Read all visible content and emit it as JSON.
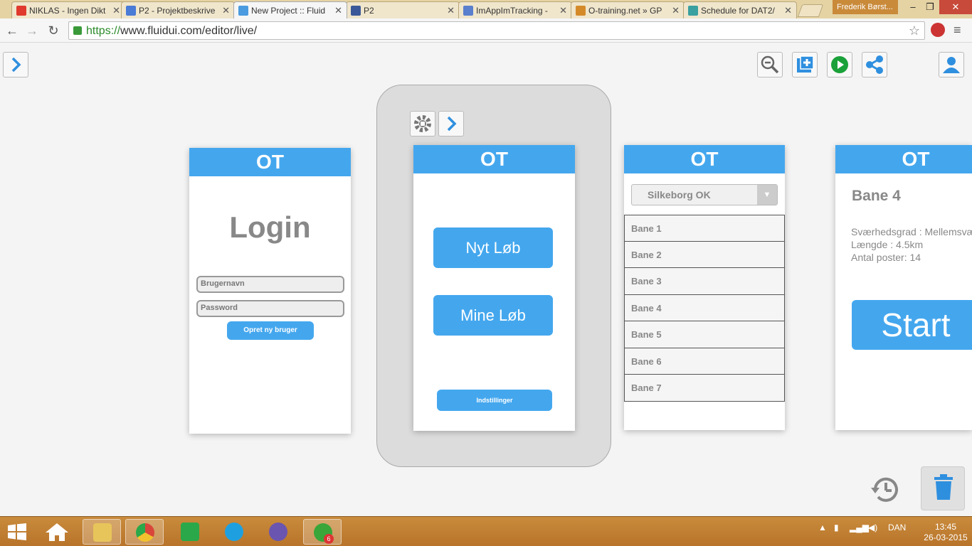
{
  "browser": {
    "tabs": [
      {
        "title": "NIKLAS - Ingen Dikt",
        "favicon_color": "#e03a2e",
        "active": false
      },
      {
        "title": "P2 - Projektbeskrive",
        "favicon_color": "#4a7bd6",
        "active": false
      },
      {
        "title": "New Project :: Fluid",
        "favicon_color": "#4a9be0",
        "active": true
      },
      {
        "title": "P2",
        "favicon_color": "#3b5998",
        "active": false
      },
      {
        "title": "ImAppImTracking -",
        "favicon_color": "#5a7fcc",
        "active": false
      },
      {
        "title": "O-training.net » GP",
        "favicon_color": "#d58a2a",
        "active": false
      },
      {
        "title": "Schedule for DAT2/",
        "favicon_color": "#3aa0a0",
        "active": false
      }
    ],
    "close_glyph": "✕",
    "profile_name": "Frederik Børst...",
    "window_controls": {
      "minimize": "–",
      "maximize": "❐",
      "close": "✕"
    },
    "url_scheme": "https://",
    "url_rest": "www.fluidui.com/editor/live/"
  },
  "editor": {
    "toolbar_icons": [
      "expand-panel-icon",
      "zoom-out-icon",
      "add-screen-icon",
      "play-icon",
      "share-icon",
      "user-icon"
    ],
    "device_icons": [
      "settings-icon",
      "next-arrow-icon"
    ],
    "bottom_icons": [
      "history-icon",
      "trash-icon"
    ],
    "accent_color": "#44a7ee"
  },
  "screens": {
    "login": {
      "header": "OT",
      "title": "Login",
      "username_placeholder": "Brugernavn",
      "password_placeholder": "Password",
      "create_user_label": "Opret ny bruger"
    },
    "menu": {
      "header": "OT",
      "new_run_label": "Nyt Løb",
      "my_runs_label": "Mine Løb",
      "settings_label": "Indstillinger"
    },
    "courses": {
      "header": "OT",
      "club_selected": "Silkeborg OK",
      "dropdown_glyph": "▼",
      "items": [
        "Bane 1",
        "Bane 2",
        "Bane 3",
        "Bane 4",
        "Bane 5",
        "Bane 6",
        "Bane 7"
      ]
    },
    "detail": {
      "header": "OT",
      "title": "Bane 4",
      "difficulty": "Sværhedsgrad : Mellemsvær",
      "length": "Længde : 4.5km",
      "posts": "Antal poster: 14",
      "start_label": "Start"
    }
  },
  "taskbar": {
    "apps": [
      {
        "name": "file-explorer",
        "color": "#e8c55a",
        "active": true
      },
      {
        "name": "chrome",
        "color": "#d9453a",
        "active": true
      },
      {
        "name": "store",
        "color": "#2aa84a",
        "active": false
      },
      {
        "name": "skype",
        "color": "#1ea0e0",
        "active": false
      },
      {
        "name": "app-cat",
        "color": "#6a55b0",
        "active": false
      },
      {
        "name": "spotify",
        "color": "#3aa63a",
        "active": false
      }
    ],
    "spotify_badge": "6",
    "language": "DAN",
    "time": "13:45",
    "date": "26-03-2015"
  }
}
